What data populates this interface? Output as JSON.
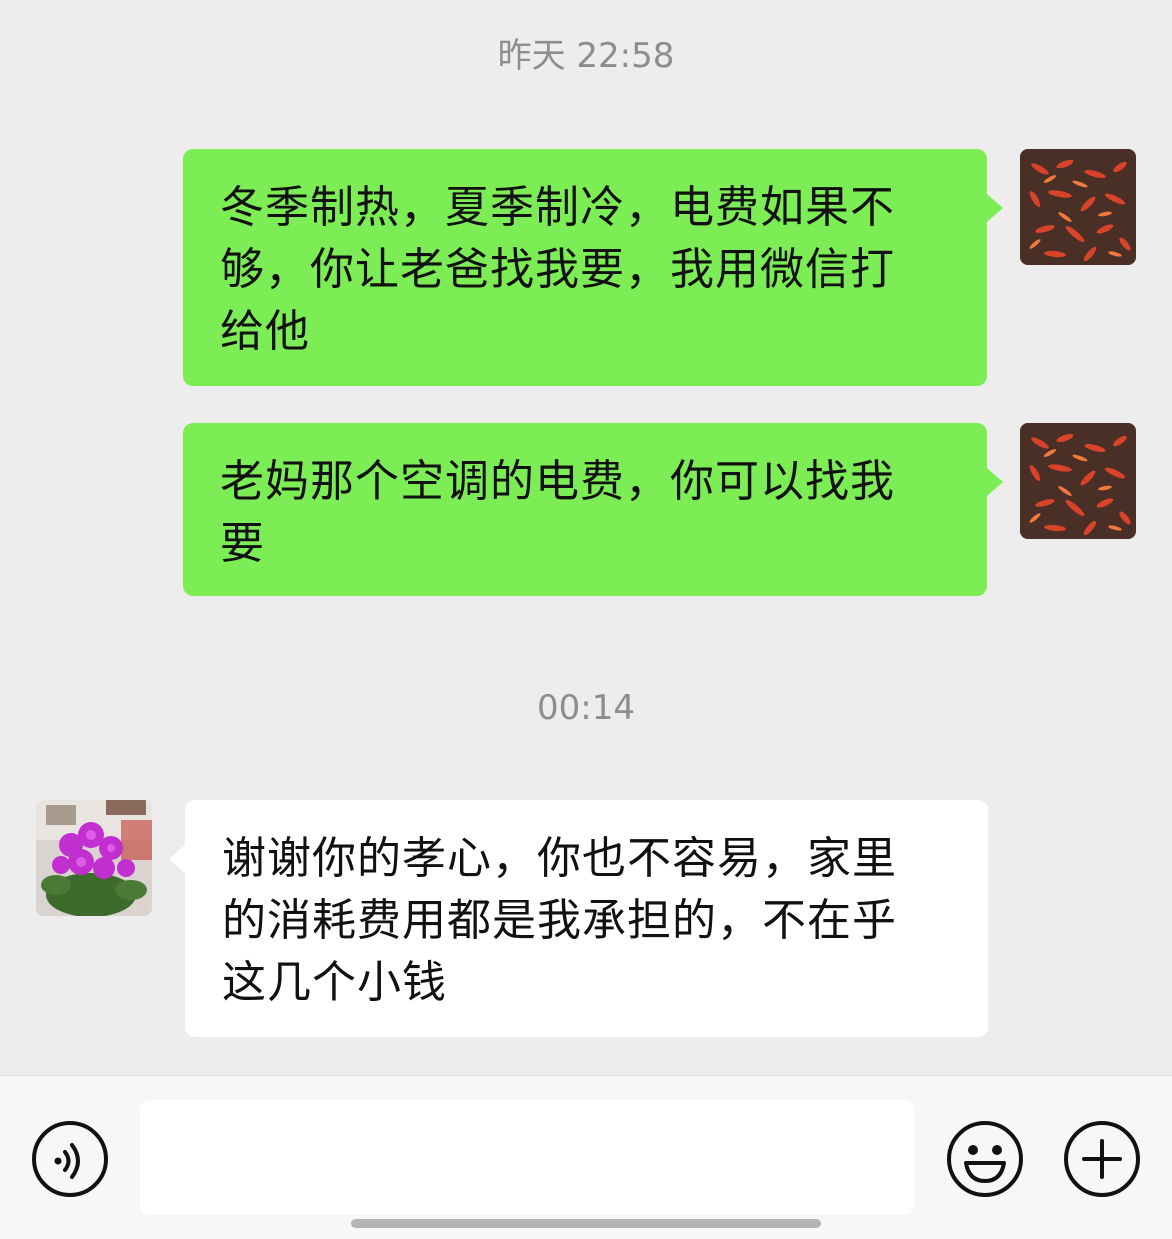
{
  "chat": {
    "timestamp_1": "昨天 22:58",
    "timestamp_2": "00:14",
    "messages": [
      {
        "direction": "sent",
        "lines": [
          "冬季制热，夏季制冷，电费如果不",
          "够，你让老爸找我要，我用微信打",
          "给他"
        ]
      },
      {
        "direction": "sent",
        "lines": [
          "老妈那个空调的电费，你可以找我",
          "要"
        ]
      },
      {
        "direction": "received",
        "lines": [
          "谢谢你的孝心，你也不容易，家里",
          "的消耗费用都是我承担的，不在乎",
          "这几个小钱"
        ]
      }
    ],
    "self_avatar": "koi-fish-pond-avatar",
    "contact_avatar": "purple-flower-avatar"
  },
  "input_bar": {
    "voice_icon": "voice-icon",
    "emoji_icon": "emoji-icon",
    "plus_icon": "plus-icon",
    "text_value": ""
  },
  "colors": {
    "sent_bubble": "#7ded56",
    "received_bubble": "#ffffff",
    "background": "#ededed"
  }
}
